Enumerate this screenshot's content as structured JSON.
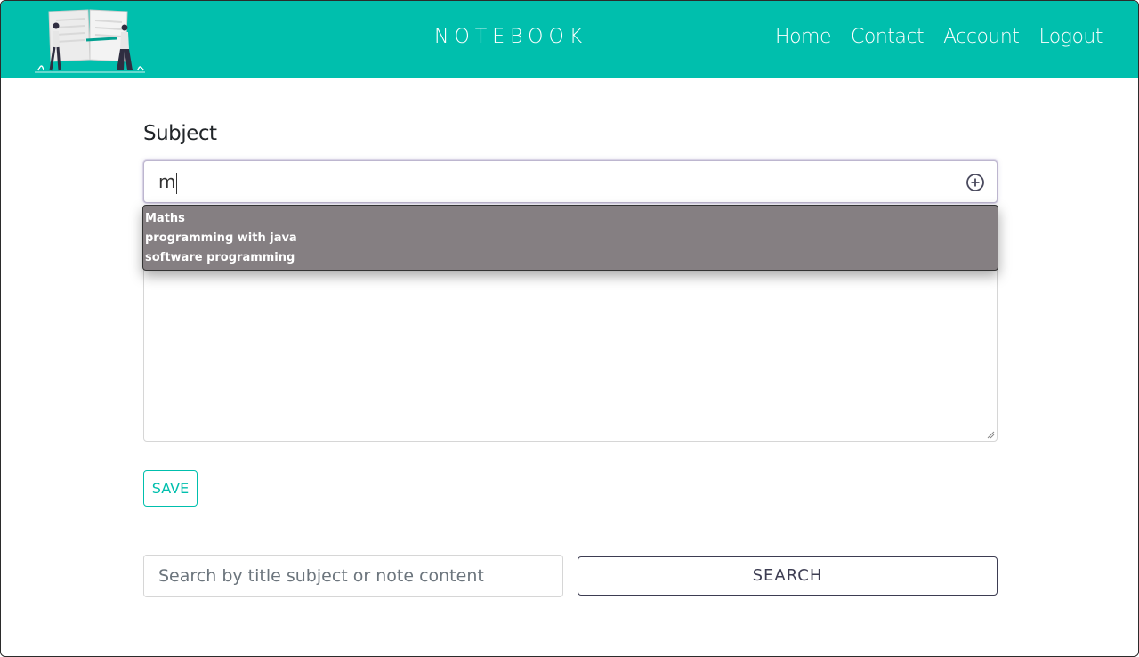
{
  "header": {
    "brand": "NOTEBOOK",
    "nav": [
      "Home",
      "Contact",
      "Account",
      "Logout"
    ],
    "background_color": "#00bfad"
  },
  "form": {
    "subject_label": "Subject",
    "subject_value": "m",
    "add_icon": "plus-circle-icon",
    "suggestions": [
      "Maths",
      "programming with java",
      "software programming"
    ],
    "save_label": "SAVE"
  },
  "search": {
    "placeholder": "Search by title subject or note content",
    "button_label": "SEARCH"
  }
}
